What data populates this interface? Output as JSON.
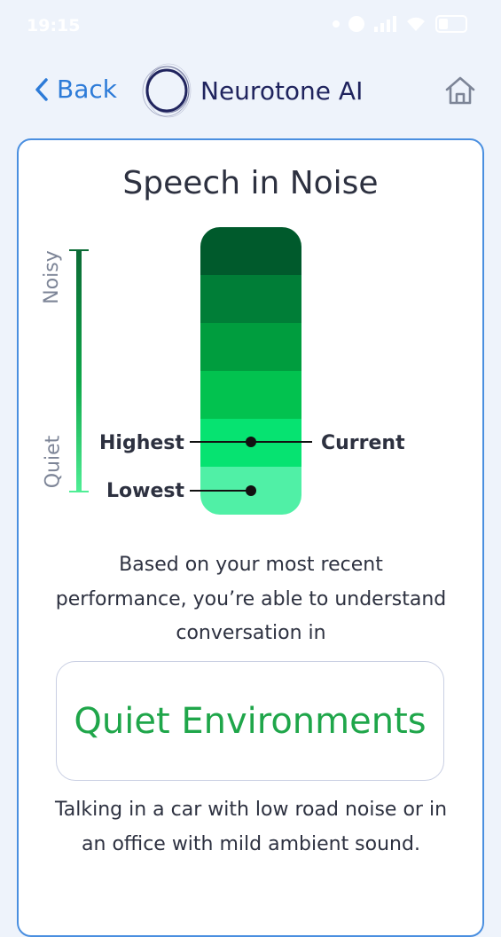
{
  "status_bar": {
    "time": "19:15"
  },
  "header": {
    "back_label": "Back",
    "brand_name": "Neurotone AI"
  },
  "card": {
    "title": "Speech in Noise",
    "axis": {
      "top_label": "Noisy",
      "bottom_label": "Quiet"
    },
    "meter": {
      "level_colors": [
        "#005a2c",
        "#007e37",
        "#009d3e",
        "#02c24f",
        "#06e371",
        "#50f0a6"
      ],
      "markers": {
        "highest_label": "Highest",
        "current_label": "Current",
        "lowest_label": "Lowest"
      }
    },
    "description": "Based on your most recent performance, you’re able to understand conversation in",
    "result": "Quiet Environments",
    "example": "Talking in a car with low road noise or in an office with mild ambient sound.",
    "accent_color": "#1fa64a"
  }
}
